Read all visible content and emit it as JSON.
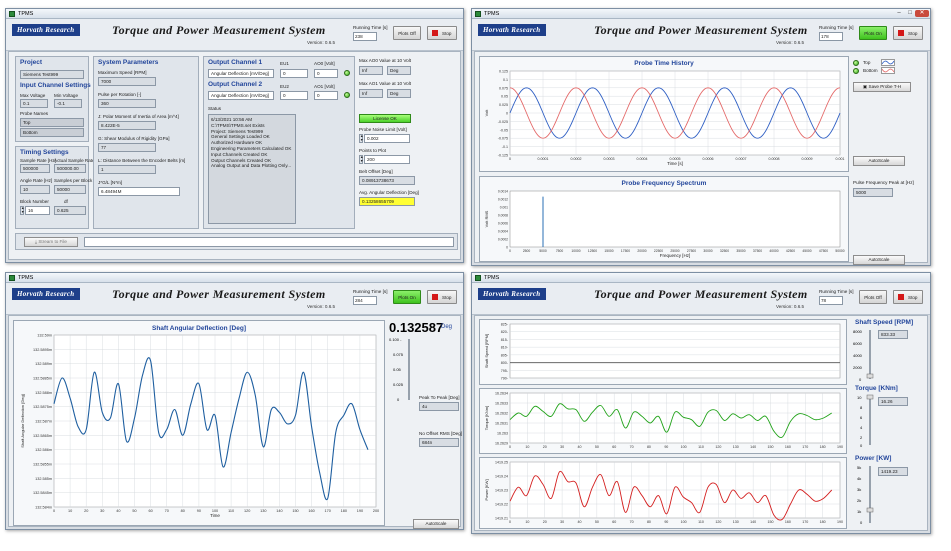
{
  "app": {
    "window_title": "TPMS",
    "logo": "Horvath Research",
    "title": "Torque and Power Measurement System",
    "version": "Version: 0.6.5",
    "running_time_label": "Running Time [s]",
    "stop_label": "Stop",
    "tabs": [
      "Settings",
      "Development",
      "Probe Time History",
      "Angular Deflection",
      "Shaft Speed",
      "Torque",
      "Power",
      "Combined Plots"
    ]
  },
  "windows": [
    {
      "running_time": "238",
      "plots_label": "Plots Off",
      "plots_on": false,
      "active_tab": 0
    },
    {
      "running_time": "178",
      "plots_label": "Plots On",
      "plots_on": true,
      "active_tab": 2
    },
    {
      "running_time": "284",
      "plots_label": "Plots On",
      "plots_on": true,
      "active_tab": 3
    },
    {
      "running_time": "78",
      "plots_label": "Plots Off",
      "plots_on": false,
      "active_tab": 7
    }
  ],
  "settings": {
    "project_heading": "Project",
    "project_name": "Siemens Test999",
    "input_heading": "Input Channel Settings",
    "max_voltage_label": "Max Voltage",
    "max_voltage": "0.1",
    "min_voltage_label": "Min Voltage",
    "min_voltage": "-0.1",
    "probe_names_label": "Probe Names",
    "probe_names": [
      "Top",
      "Bottom"
    ],
    "timing_heading": "Timing Settings",
    "sample_rate_label": "Sample Rate [Hz]",
    "sample_rate": "500000",
    "actual_sample_rate_label": "Actual Sample Rate",
    "actual_sample_rate": "500000.00",
    "angle_rate_label": "Angle Rate [Hz]",
    "angle_rate": "10",
    "samples_per_block_label": "Samples per Block",
    "samples_per_block": "50000",
    "block_number_label": "Block Number",
    "block_number": "16",
    "df_label": "df",
    "df": "0.625",
    "system_heading": "System Parameters",
    "max_speed_label": "Maximum Speed [RPM]",
    "max_speed": "7000",
    "pulse_label": "Pulse per Rotation [-]",
    "pulse": "360",
    "polar_label": "J: Polar Moment of Inertia of Area [m^4]",
    "polar": "8.422E-5",
    "shear_label": "G: Shear Modulus of Rigidity [GPa]",
    "shear": "77",
    "distance_label": "L: Distance Between the Encoder Belts [m]",
    "distance": "1",
    "jgl_label": "J*G/L [N*m]",
    "jgl": "6.48494M",
    "out1_heading": "Output Channel 1",
    "out1_select": "Angular Deflection [mV/Deg]",
    "eu1_label": "EU1",
    "eu1": "0",
    "ao0_label": "AO0 [Volt]",
    "ao0": "0",
    "out2_heading": "Output Channel 2",
    "out2_select": "Angular Deflection [mV/Deg]",
    "eu2_label": "EU2",
    "eu2": "0",
    "ao1_label": "AO1 [Volt]",
    "ao1": "0",
    "max_ao0_label": "Max AO0 Value at 10 Volt",
    "max_ao0": "Inf",
    "max_ao0_unit": "Deg",
    "max_ao1_label": "Max AO1 Value at 10 Volt",
    "max_ao1": "Inf",
    "max_ao1_unit": "Deg",
    "status_label": "Status",
    "status_lines": [
      "6/13/2021 10:56 AM",
      "C:\\TPMS\\TPMS.set Exists",
      "Project: Siemens Test999",
      "General Settings Loaded OK",
      "Authorized Hardware OK",
      "Engineering Parameters Calculated OK",
      "Input Channels Created OK",
      "Output Channels Created OK",
      "Analog Output and Data Plotting Only..."
    ],
    "license_label": "License OK",
    "noise_label": "Probe Noise Limit [Volt]",
    "noise": "0.002",
    "points_label": "Points to Plot",
    "points": "200",
    "belt_label": "Belt Offset [Deg]",
    "belt": "0.08913738673",
    "avg_label": "Avg. Angular Deflection [Deg]",
    "avg": "0.13258655709",
    "stream_label": "Stream to File"
  },
  "probe": {
    "title": "Probe Time History",
    "legend": [
      "Top",
      "Bottom"
    ],
    "save_label": "Save Probe T-H",
    "autoscale_label": "AutoScale",
    "freq_title": "Probe Frequency Spectrum",
    "peak_label": "Pulse Frequency Peak at [Hz]",
    "peak_value": "5000",
    "colors": {
      "top": "#2f5fc4",
      "bottom": "#e46a6a",
      "spectrum": "#2a6fb5"
    }
  },
  "deflection": {
    "title": "Shaft Angular Deflection [Deg]",
    "current_value": "0.132587",
    "unit": "Deg",
    "p2p_label": "Peak To Peak [Deg]",
    "p2p_value": "4u",
    "rms_label": "No Offset RMS [Deg]",
    "rms_value": "684n",
    "autoscale_label": "AutoScale",
    "color": "#1f5fa0"
  },
  "combined": {
    "speed_label": "Shaft Speed [RPM]",
    "speed_value": "833.33",
    "torque_label": "Torque [KNm]",
    "torque_value": "16.26",
    "power_label": "Power [KW]",
    "power_value": "1419.23",
    "colors": {
      "speed": "#555555",
      "torque": "#22a31a",
      "power": "#d41e1e"
    }
  },
  "chart_data": [
    {
      "type": "line",
      "title": "Probe Time History",
      "xlabel": "Time [s]",
      "ylabel": "Volt",
      "xlim": [
        0,
        0.001
      ],
      "ylim": [
        -0.125,
        0.125
      ],
      "xticks": [
        "0",
        "0.0001",
        "0.0002",
        "0.0003",
        "0.0004",
        "0.0005",
        "0.0006",
        "0.0007",
        "0.0008",
        "0.0009",
        "0.001"
      ],
      "yticks": [
        "0.125",
        "0.1",
        "0.075",
        "0.05",
        "0.025",
        "0",
        "-0.025",
        "-0.05",
        "-0.075",
        "-0.1",
        "-0.125"
      ],
      "series": [
        {
          "name": "Top",
          "amplitude": 0.075,
          "frequency_hz": 5000,
          "phase_deg": 0
        },
        {
          "name": "Bottom",
          "amplitude": 0.075,
          "frequency_hz": 5000,
          "phase_deg": 90
        }
      ]
    },
    {
      "type": "bar",
      "title": "Probe Frequency Spectrum",
      "xlabel": "Frequency [Hz]",
      "ylabel": "Volt RMS",
      "xlim": [
        0,
        50000
      ],
      "ylim": [
        0,
        0.0014
      ],
      "xticks": [
        "0",
        "2500",
        "5000",
        "7500",
        "10000",
        "12500",
        "15000",
        "17500",
        "20000",
        "22500",
        "25000",
        "27500",
        "30000",
        "32500",
        "35000",
        "37500",
        "40000",
        "42500",
        "45000",
        "47500",
        "50000"
      ],
      "yticks": [
        "0.0014",
        "0.0012",
        "0.001",
        "0.0008",
        "0.0006",
        "0.0004",
        "0.0002",
        "0"
      ],
      "x": [
        5000
      ],
      "values": [
        0.00126
      ]
    },
    {
      "type": "line",
      "title": "Shaft Angular Deflection [Deg]",
      "xlabel": "Time",
      "ylabel": "Shaft Angular Deflection [Deg]",
      "xlim": [
        0,
        200
      ],
      "ylim": [
        132.584,
        132.59
      ],
      "xticks": [
        "0",
        "10",
        "20",
        "30",
        "40",
        "50",
        "60",
        "70",
        "80",
        "90",
        "100",
        "110",
        "120",
        "130",
        "140",
        "150",
        "160",
        "170",
        "180",
        "190",
        "200"
      ],
      "yticks": [
        "132.59m",
        "132.5895m",
        "132.589m",
        "132.5885m",
        "132.588m",
        "132.5875m",
        "132.587m",
        "132.5865m",
        "132.586m",
        "132.5855m",
        "132.585m",
        "132.5845m",
        "132.584m"
      ],
      "x": [
        0,
        5,
        10,
        15,
        20,
        25,
        30,
        35,
        40,
        45,
        50,
        55,
        60,
        65,
        70,
        75,
        80,
        85,
        90,
        95,
        100,
        105,
        110,
        115,
        120,
        125,
        130,
        135,
        140,
        145,
        150,
        155,
        160,
        165,
        170,
        175,
        180,
        185,
        190,
        195
      ],
      "values": [
        132.5876,
        132.5885,
        132.5878,
        132.5868,
        132.5867,
        132.5887,
        132.5873,
        132.5871,
        132.5883,
        132.5863,
        132.5871,
        132.5886,
        132.5891,
        132.5866,
        132.5867,
        132.5874,
        132.5865,
        132.5876,
        132.5883,
        132.5867,
        132.5872,
        132.5854,
        132.5866,
        132.5878,
        132.5887,
        132.5879,
        132.5861,
        132.5874,
        132.5873,
        132.5869,
        132.5872,
        132.5887,
        132.5868,
        132.5852,
        132.5843,
        132.5866,
        132.5872,
        132.5876,
        132.5867,
        132.586
      ]
    },
    {
      "type": "line",
      "title": "Shaft Speed",
      "ylabel": "Shaft Speed [RPM]",
      "xlim": [
        0,
        200
      ],
      "ylim": [
        790,
        850
      ],
      "yticks": [
        "825-",
        "820-",
        "815-",
        "810-",
        "805-",
        "800-",
        "795-",
        "790-"
      ],
      "x": [
        0,
        200
      ],
      "values": [
        833.33,
        833.33
      ]
    },
    {
      "type": "line",
      "title": "Torque",
      "ylabel": "Torque [KNm]",
      "xlim": [
        0,
        200
      ],
      "ylim": [
        16.2629,
        16.2635
      ],
      "yticks": [
        "16.2634",
        "16.2633",
        "16.2632",
        "16.2631",
        "16.263",
        "16.2629"
      ],
      "xticks": [
        "0",
        "10",
        "20",
        "30",
        "40",
        "50",
        "60",
        "70",
        "80",
        "90",
        "100",
        "110",
        "120",
        "130",
        "140",
        "150",
        "160",
        "170",
        "180",
        "190"
      ],
      "x": [
        0,
        5,
        10,
        15,
        20,
        25,
        30,
        35,
        40,
        45,
        50,
        55,
        60,
        65,
        70,
        75,
        80,
        85,
        90,
        95,
        100,
        105,
        110,
        115,
        120,
        125,
        130,
        135,
        140,
        145,
        150,
        155,
        160,
        165,
        170,
        175,
        180,
        185,
        190,
        195
      ],
      "values": [
        16.26318,
        16.26326,
        16.26322,
        16.26334,
        16.26328,
        16.26322,
        16.26337,
        16.26331,
        16.2633,
        16.26316,
        16.26327,
        16.26335,
        16.26322,
        16.2633,
        16.26308,
        16.26327,
        16.26322,
        16.26314,
        16.26322,
        16.26303,
        16.26327,
        16.26321,
        16.26318,
        16.2631,
        16.26327,
        16.26329,
        16.26317,
        16.26325,
        16.2632,
        16.26324,
        16.26317,
        16.26322,
        16.26304,
        16.26297,
        16.26316,
        16.26325,
        16.26323,
        16.26318,
        16.2632,
        16.26326
      ]
    },
    {
      "type": "line",
      "title": "Power",
      "ylabel": "Power [KW]",
      "xlim": [
        0,
        200
      ],
      "ylim": [
        1419.21,
        1419.25
      ],
      "yticks": [
        "1419.25",
        "1419.24",
        "1419.23",
        "1419.22",
        "1419.21"
      ],
      "xticks": [
        "0",
        "10",
        "20",
        "30",
        "40",
        "50",
        "60",
        "70",
        "80",
        "90",
        "100",
        "110",
        "120",
        "130",
        "140",
        "150",
        "160",
        "170",
        "180",
        "190"
      ],
      "x": [
        0,
        5,
        10,
        15,
        20,
        25,
        30,
        35,
        40,
        45,
        50,
        55,
        60,
        65,
        70,
        75,
        80,
        85,
        90,
        95,
        100,
        105,
        110,
        115,
        120,
        125,
        130,
        135,
        140,
        145,
        150,
        155,
        160,
        165,
        170,
        175,
        180,
        185,
        190,
        195
      ],
      "values": [
        1419.222,
        1419.232,
        1419.226,
        1419.24,
        1419.234,
        1419.224,
        1419.243,
        1419.236,
        1419.235,
        1419.218,
        1419.232,
        1419.241,
        1419.226,
        1419.236,
        1419.214,
        1419.232,
        1419.226,
        1419.218,
        1419.226,
        1419.213,
        1419.232,
        1419.225,
        1419.221,
        1419.214,
        1419.232,
        1419.234,
        1419.221,
        1419.23,
        1419.224,
        1419.228,
        1419.221,
        1419.226,
        1419.212,
        1419.209,
        1419.22,
        1419.23,
        1419.227,
        1419.222,
        1419.224,
        1419.23
      ]
    }
  ]
}
